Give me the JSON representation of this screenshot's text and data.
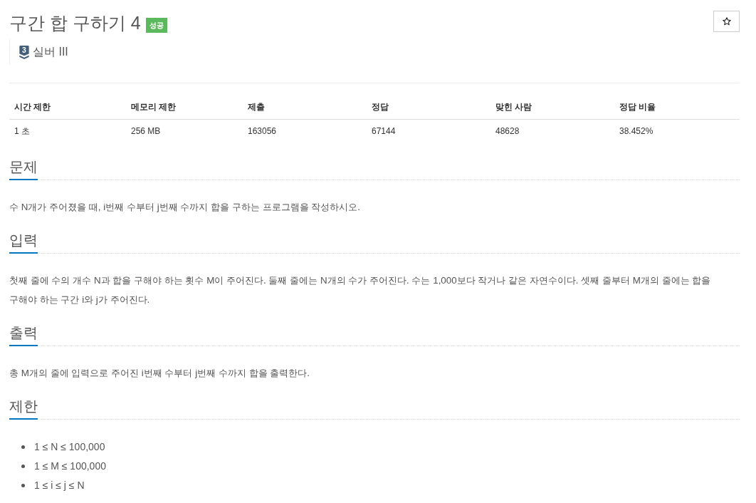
{
  "problem": {
    "title": "구간 합 구하기 4",
    "result_badge": "성공",
    "tier": {
      "number": "3",
      "label": "실버 III"
    }
  },
  "favorite_button": {
    "starred": false
  },
  "stats_table": {
    "columns": [
      "시간 제한",
      "메모리 제한",
      "제출",
      "정답",
      "맞힌 사람",
      "정답 비율"
    ],
    "rows": [
      [
        "1 초",
        "256 MB",
        "163056",
        "67144",
        "48628",
        "38.452%"
      ]
    ]
  },
  "sections": [
    {
      "heading": "문제",
      "kind": "paragraph",
      "text": "수 N개가 주어졌을 때, i번째 수부터 j번째 수까지 합을 구하는 프로그램을 작성하시오."
    },
    {
      "heading": "입력",
      "kind": "paragraph",
      "text": "첫째 줄에 수의 개수 N과 합을 구해야 하는 횟수 M이 주어진다. 둘째 줄에는 N개의 수가 주어진다. 수는 1,000보다 작거나 같은 자연수이다. 셋째 줄부터 M개의 줄에는 합을 구해야 하는 구간 i와 j가 주어진다."
    },
    {
      "heading": "출력",
      "kind": "paragraph",
      "text": "총 M개의 줄에 입력으로 주어진 i번째 수부터 j번째 수까지 합을 출력한다."
    },
    {
      "heading": "제한",
      "kind": "list",
      "items": [
        "1 ≤ N ≤ 100,000",
        "1 ≤ M ≤ 100,000",
        "1 ≤ i ≤ j ≤ N"
      ]
    }
  ]
}
